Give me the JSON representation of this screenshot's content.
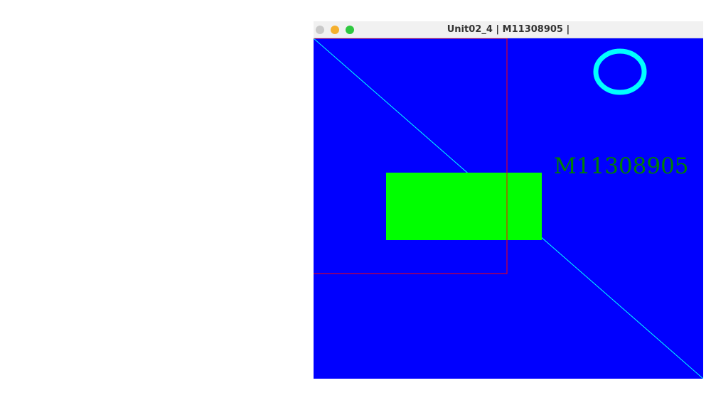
{
  "window": {
    "title": "Unit02_4 | M11308905 |"
  },
  "canvas": {
    "background_color": "#0000ff",
    "text": "M11308905",
    "text_color": "#008000",
    "rectangle_color": "#00ff00",
    "outline_color": "#ff0000",
    "circle_color": "#00ffff",
    "line_color": "#00ffff"
  },
  "colors": {
    "close_button": "#c9c9c9",
    "minimize_button": "#f5b02e",
    "zoom_button": "#2fc840"
  }
}
